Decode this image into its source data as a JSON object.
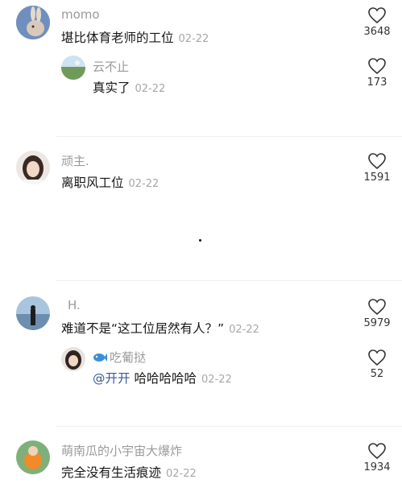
{
  "comments": [
    {
      "user": "momo",
      "text": "堪比体育老师的工位",
      "date": "02-22",
      "likes": "3648",
      "reply": {
        "user": "云不止",
        "text": "真实了",
        "date": "02-22",
        "likes": "173"
      }
    },
    {
      "user": "顽主.",
      "text": "离职风工位",
      "date": "02-22",
      "likes": "1591"
    },
    {
      "user": "H.",
      "text": "难道不是“这工位居然有人？”",
      "date": "02-22",
      "likes": "5979",
      "reply": {
        "user": "吃葡挞",
        "mention": "@开开",
        "text": "哈哈哈哈哈",
        "date": "02-22",
        "likes": "52"
      }
    },
    {
      "user": "萌南瓜的小宇宙大爆炸",
      "text": "完全没有生活痕迹",
      "date": "02-22",
      "likes": "1934"
    }
  ],
  "icons": {
    "like": "heart-outline-icon",
    "fish": "fish-emoji-icon"
  }
}
